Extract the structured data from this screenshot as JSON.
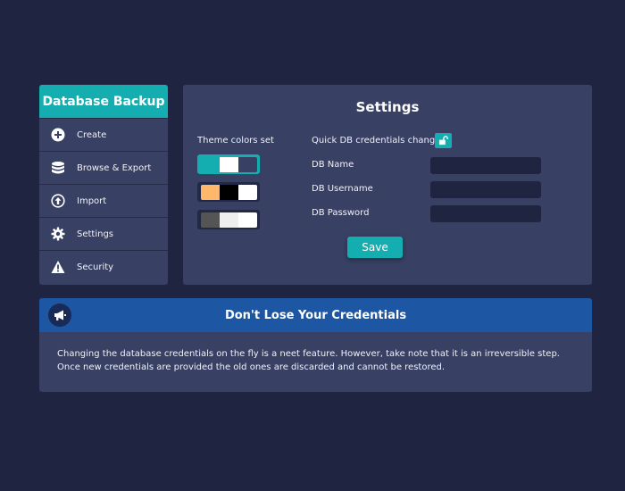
{
  "sidebar": {
    "title": "Database Backup",
    "items": [
      {
        "label": "Create",
        "icon": "plus-circle-icon"
      },
      {
        "label": "Browse & Export",
        "icon": "database-icon"
      },
      {
        "label": "Import",
        "icon": "upload-circle-icon"
      },
      {
        "label": "Settings",
        "icon": "gear-icon"
      },
      {
        "label": "Security",
        "icon": "warning-icon"
      }
    ]
  },
  "settings": {
    "title": "Settings",
    "theme_label": "Theme colors set",
    "themes": [
      {
        "colors": [
          "#15aeb0",
          "#ffffff",
          "#384064"
        ],
        "active": true
      },
      {
        "colors": [
          "#ffb86b",
          "#000000",
          "#ffffff"
        ],
        "active": false
      },
      {
        "colors": [
          "#555555",
          "#eeeeee",
          "#ffffff"
        ],
        "active": false
      }
    ],
    "quick_label": "Quick DB credentials change",
    "lock_icon": "unlock-icon",
    "fields": [
      {
        "label": "DB Name",
        "value": ""
      },
      {
        "label": "DB Username",
        "value": ""
      },
      {
        "label": "DB Password",
        "value": ""
      }
    ],
    "save_label": "Save"
  },
  "notice": {
    "icon": "megaphone-icon",
    "title": "Don't Lose Your Credentials",
    "body": "Changing the database credentials on the fly is a neet feature. However, take note that it is an irreversible step. Once new credentials are provided the old ones are discarded and cannot be restored."
  },
  "colors": {
    "background": "#1f2540",
    "panel": "#384064",
    "accent": "#15aeb0",
    "notice_header": "#1d56a2"
  }
}
